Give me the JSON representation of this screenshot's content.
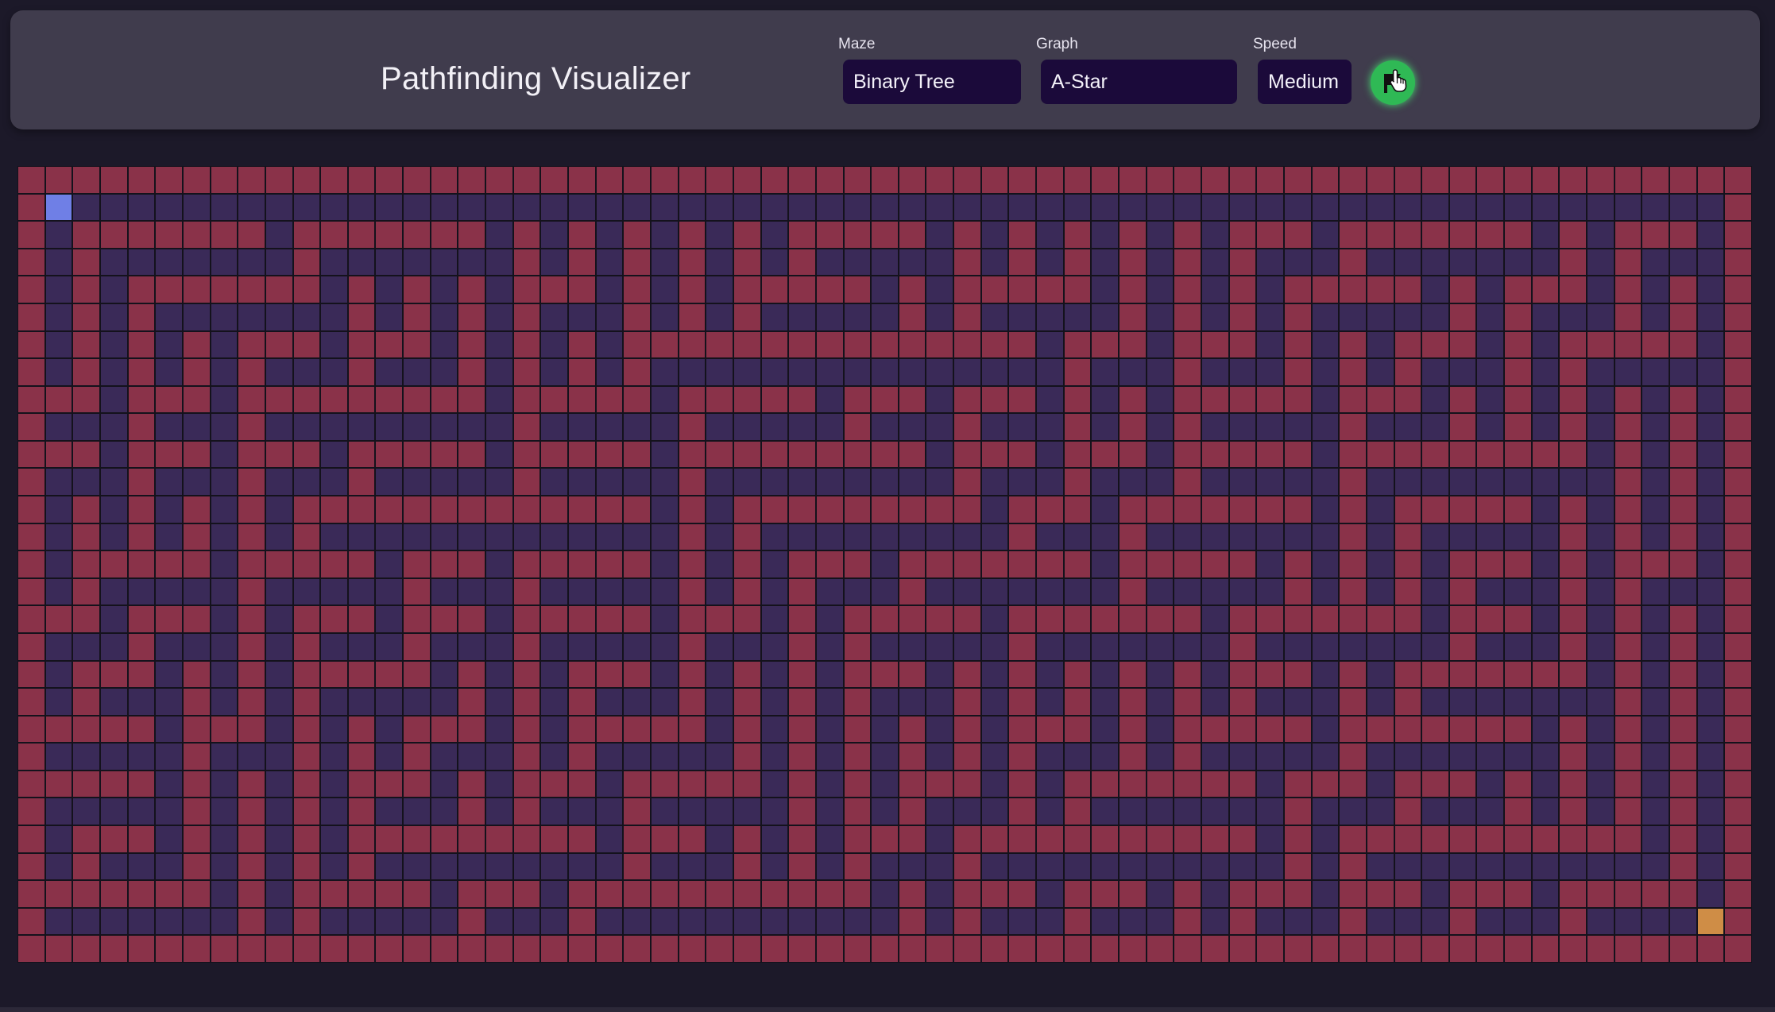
{
  "app": {
    "title": "Pathfinding Visualizer"
  },
  "controls": {
    "maze": {
      "label": "Maze",
      "value": "Binary Tree"
    },
    "graph": {
      "label": "Graph",
      "value": "A-Star"
    },
    "speed": {
      "label": "Speed",
      "value": "Medium"
    },
    "play_button": {
      "icon": "flag-icon"
    }
  },
  "grid": {
    "rows": 29,
    "cols": 63,
    "start": {
      "row": 1,
      "col": 1
    },
    "end": {
      "row": 27,
      "col": 61
    },
    "colors": {
      "wall": "#8a3249",
      "open": "#3a2a58",
      "start": "#6f7fe6",
      "end": "#cf8d46",
      "header": "#403c4d",
      "select": "#1b0a3a",
      "play": "#2fb955"
    }
  }
}
